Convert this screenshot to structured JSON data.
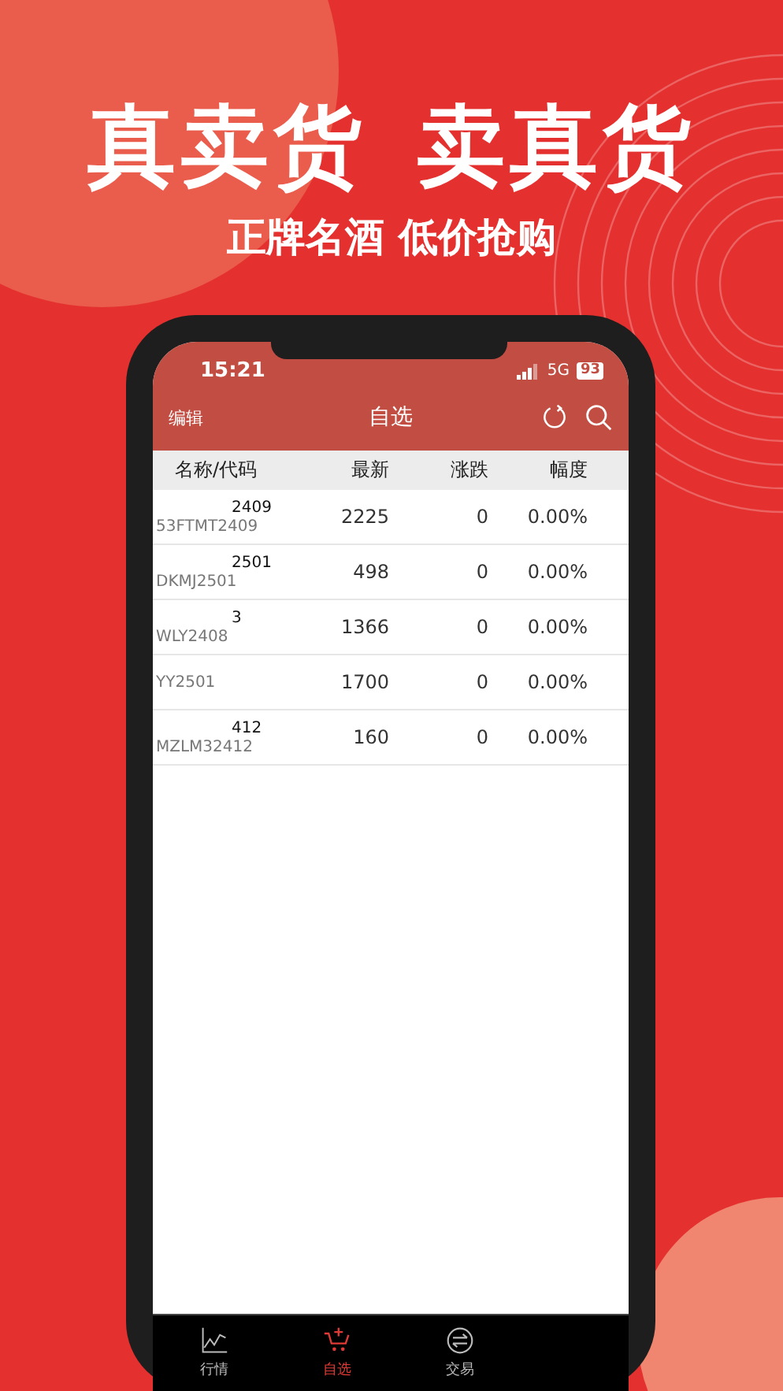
{
  "headline": "真卖货 卖真货",
  "subtitle": "正牌名酒 低价抢购",
  "status_bar": {
    "time": "15:21",
    "network": "5G",
    "battery": "93"
  },
  "nav": {
    "left": "编辑",
    "title": "自选"
  },
  "table": {
    "columns": [
      "名称/代码",
      "最新",
      "涨跌",
      "幅度"
    ],
    "rows": [
      {
        "name": "2409",
        "code": "53FTMT2409",
        "price": "2225",
        "change": "0",
        "pct": "0.00%"
      },
      {
        "name": "2501",
        "code": "DKMJ2501",
        "price": "498",
        "change": "0",
        "pct": "0.00%"
      },
      {
        "name": "3",
        "code": "WLY2408",
        "price": "1366",
        "change": "0",
        "pct": "0.00%"
      },
      {
        "name": "",
        "code": "YY2501",
        "price": "1700",
        "change": "0",
        "pct": "0.00%"
      },
      {
        "name": "412",
        "code": "MZLM32412",
        "price": "160",
        "change": "0",
        "pct": "0.00%"
      }
    ]
  },
  "tabs": [
    {
      "kind": "chart",
      "label": "行情",
      "selected": false
    },
    {
      "kind": "cart",
      "label": "自选",
      "selected": true
    },
    {
      "kind": "swap",
      "label": "交易",
      "selected": false
    }
  ]
}
